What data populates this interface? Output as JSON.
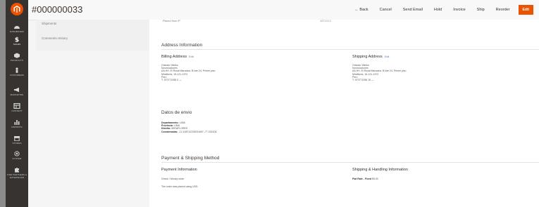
{
  "header": {
    "order_number": "#000000033",
    "actions": {
      "back": "← Back",
      "cancel": "Cancel",
      "send_email": "Send Email",
      "hold": "Hold",
      "invoice": "Invoice",
      "ship": "Ship",
      "reorder": "Reorder",
      "edit": "Edit"
    }
  },
  "admin_nav": [
    {
      "label": "Dashboard",
      "icon": "speedometer-icon"
    },
    {
      "label": "Sales",
      "icon": "dollar-icon"
    },
    {
      "label": "Products",
      "icon": "cube-icon"
    },
    {
      "label": "Customers",
      "icon": "person-icon"
    },
    {
      "label": "Marketing",
      "icon": "megaphone-icon"
    },
    {
      "label": "Content",
      "icon": "layout-icon"
    },
    {
      "label": "Reports",
      "icon": "bar-chart-icon"
    },
    {
      "label": "Stores",
      "icon": "store-icon"
    },
    {
      "label": "System",
      "icon": "gear-icon"
    },
    {
      "label": "Find Partners & Extensions",
      "icon": "puzzle-icon"
    }
  ],
  "side_tabs": {
    "shipments": "Shipments",
    "comments_history": "Comments History"
  },
  "placed_from_ip": {
    "label": "Placed from IP",
    "value": "127.0.0.1"
  },
  "address_information": {
    "title": "Address Information",
    "billing": {
      "title": "Billing Address",
      "edit": "Edit",
      "lines": [
        "Orlando Yabiku",
        "Novosluciones",
        "AA.HH. El Rosal Manzana. B lote 24, Primer piso",
        "Miraflores, 15-121-1372",
        "Peru",
        "T: 970771056 0 —"
      ]
    },
    "shipping": {
      "title": "Shipping Address",
      "edit": "Edit",
      "lines": [
        "Orlando Yabiku",
        "Novosluciones",
        "AA.HH. El Rosal Manzana. B lote 24, Primer piso",
        "Miraflores, 15-121-1372",
        "Peru",
        "T: 970771056 15 —"
      ]
    }
  },
  "datos_envio": {
    "title": "Datos de envio",
    "rows": [
      {
        "label": "Departamento:",
        "value": "LIMA"
      },
      {
        "label": "Provincia:",
        "value": "LIMA"
      },
      {
        "label": "Distrito:",
        "value": "MIRAFLORES"
      },
      {
        "label": "Coordenadas:",
        "value": "-12.108712225031697,-77.032106"
      }
    ]
  },
  "payment_shipping": {
    "title": "Payment & Shipping Method",
    "payment": {
      "title": "Payment Information",
      "method": "Check / Money order",
      "note": "The order was placed using USD."
    },
    "shipping": {
      "title": "Shipping & Handling Information",
      "rate_label": "Flat Rate - Fixed",
      "rate_value": "$5.00"
    }
  },
  "colors": {
    "accent": "#eb5202",
    "nav_bg": "#373330",
    "link": "#4a7ab8"
  }
}
